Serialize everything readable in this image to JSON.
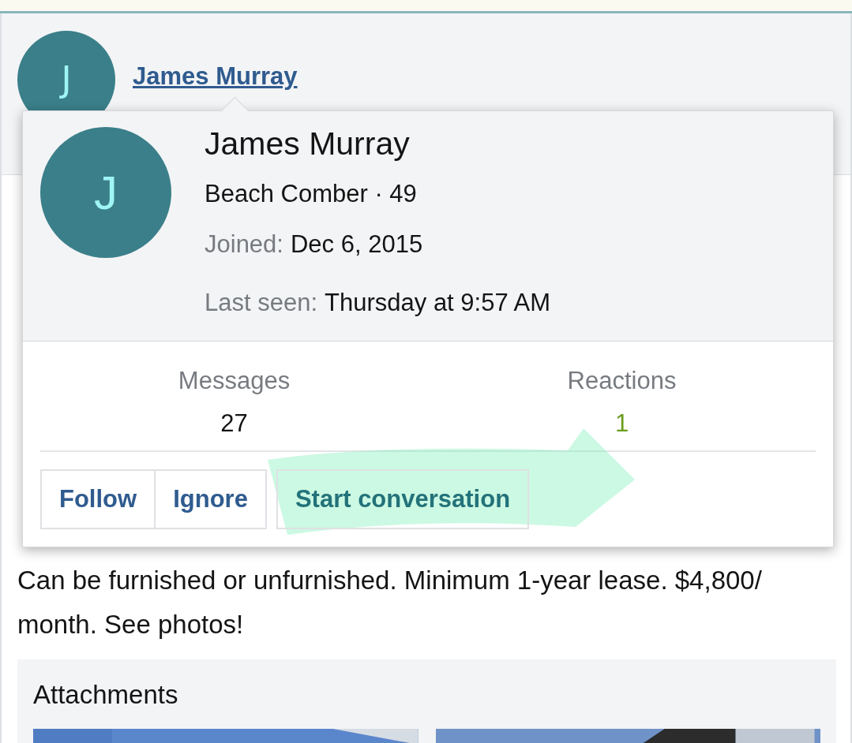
{
  "header": {
    "avatar_letter": "J",
    "name": "James Murray"
  },
  "popup": {
    "avatar_letter": "J",
    "name": "James Murray",
    "title": "Beach Comber · 49",
    "details": [
      {
        "label": "Joined:",
        "value": "Dec 6, 2015"
      },
      {
        "label": "Last seen:",
        "value": "Thursday at 9:57 AM"
      }
    ],
    "stats": [
      {
        "label": "Messages",
        "value": "27",
        "kind": "plain"
      },
      {
        "label": "Reactions",
        "value": "1",
        "kind": "positive"
      }
    ],
    "buttons": [
      {
        "label": "Follow",
        "kind": "grouped"
      },
      {
        "label": "Ignore",
        "kind": "grouped"
      },
      {
        "label": "Start conversation",
        "kind": "accent"
      }
    ]
  },
  "post": {
    "text": "Can be furnished or unfurnished. Minimum 1-year lease. $4,800/ month. See photos!"
  },
  "attachments": {
    "title": "Attachments"
  }
}
